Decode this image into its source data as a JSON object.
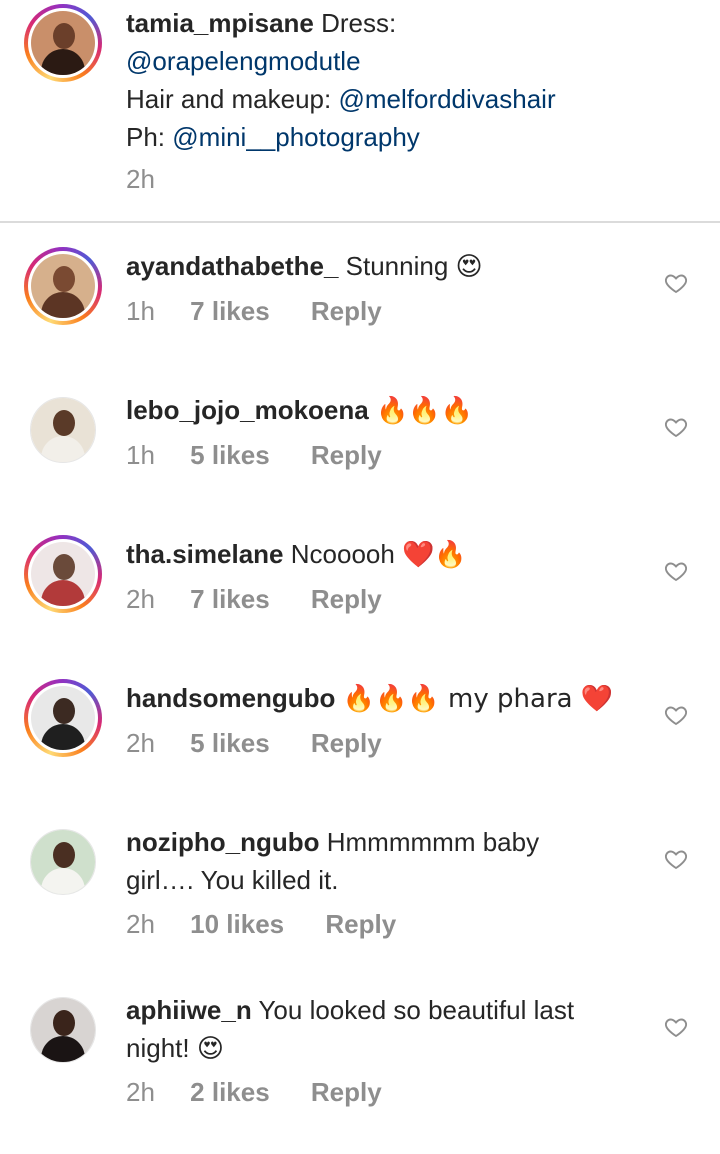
{
  "caption": {
    "username": "tamia_mpisane",
    "line1_text": "Dress:",
    "line2_mention": "@orapelengmodutle",
    "line3_text": "Hair and makeup:",
    "line3_mention": "@melforddivashair",
    "line4_text": "Ph:",
    "line4_mention": "@mini__photography",
    "time": "2h"
  },
  "comments": [
    {
      "username": "ayandathabethe_",
      "text": "Stunning",
      "emoji": "😍",
      "time": "1h",
      "likes": "7 likes",
      "reply": "Reply"
    },
    {
      "username": "lebo_jojo_mokoena",
      "text": "",
      "emoji": "🔥🔥🔥",
      "time": "1h",
      "likes": "5 likes",
      "reply": "Reply"
    },
    {
      "username": "tha.simelane",
      "text": "Ncooooh",
      "emoji": "❤️🔥",
      "time": "2h",
      "likes": "7 likes",
      "reply": "Reply"
    },
    {
      "username": "handsomengubo",
      "text": "🔥🔥🔥 my phara ❤️",
      "emoji": "",
      "time": "2h",
      "likes": "5 likes",
      "reply": "Reply"
    },
    {
      "username": "nozipho_ngubo",
      "text": "Hmmmmmm baby",
      "text2": "girl…. You killed it.",
      "time": "2h",
      "likes": "10 likes",
      "reply": "Reply"
    },
    {
      "username": "aphiiwe_n",
      "text": "You looked so beautiful last",
      "text2": "night!",
      "emoji": "😍",
      "time": "2h",
      "likes": "2 likes",
      "reply": "Reply"
    }
  ],
  "icons": {
    "like": "heart-outline-icon"
  },
  "colors": {
    "mention": "#00376b",
    "meta": "#8e8e8e",
    "divider": "#dbdbdb"
  }
}
